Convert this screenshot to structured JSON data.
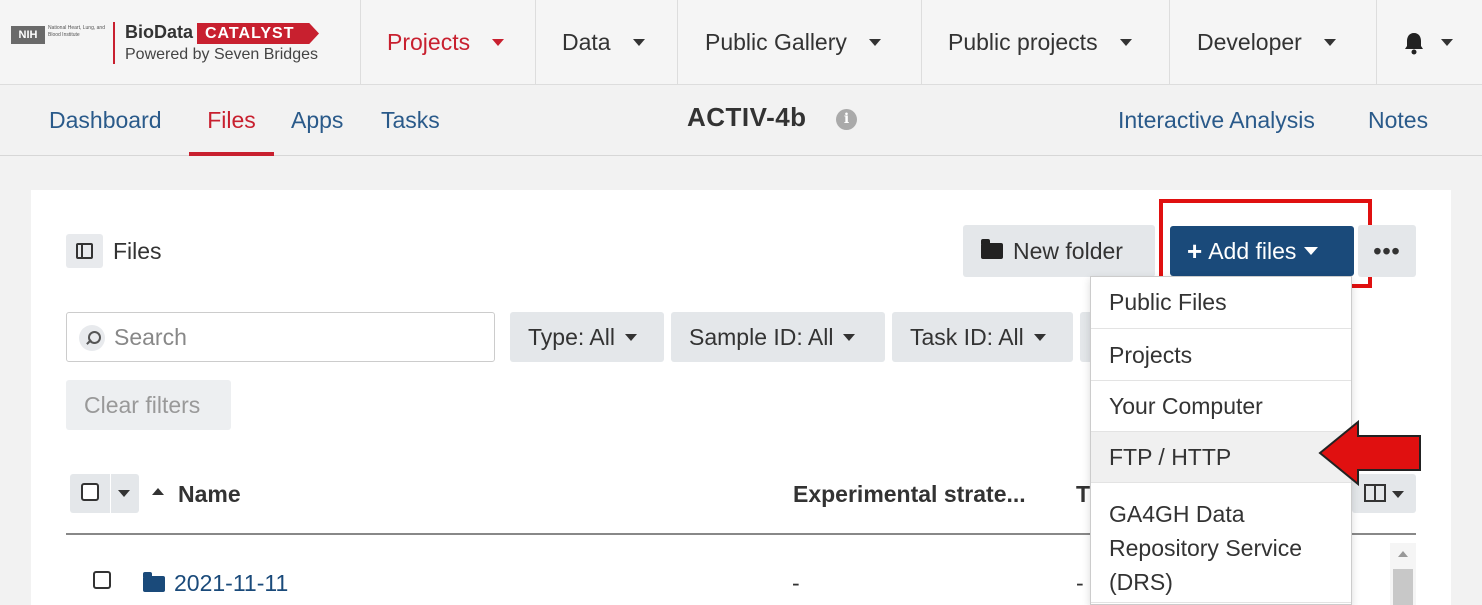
{
  "logo": {
    "nih": "NIH",
    "nih_small": "National Heart, Lung, and Blood Institute",
    "biodata": "BioData",
    "catalyst": "CATALYST",
    "powered": "Powered by Seven Bridges"
  },
  "topnav": {
    "items": [
      {
        "label": "Projects"
      },
      {
        "label": "Data"
      },
      {
        "label": "Public Gallery"
      },
      {
        "label": "Public projects"
      },
      {
        "label": "Developer"
      }
    ],
    "bell_icon": "bell-icon"
  },
  "subnav": {
    "tabs": [
      "Dashboard",
      "Files",
      "Apps",
      "Tasks"
    ],
    "project_title": "ACTIV-4b",
    "info_icon": "i",
    "right": [
      "Interactive Analysis",
      "Notes"
    ]
  },
  "files": {
    "panel_label": "Files",
    "new_folder": "New folder",
    "add_files": "Add files",
    "more": "•••",
    "search_placeholder": "Search",
    "filters": [
      "Type: All",
      "Sample ID: All",
      "Task ID: All"
    ],
    "clear_filters": "Clear filters"
  },
  "table": {
    "headers": [
      "Name",
      "Experimental strate...",
      "T"
    ],
    "rows": [
      {
        "name": "2021-11-11",
        "experimental_strategy": "-",
        "type": "-"
      }
    ]
  },
  "dropdown": {
    "items": [
      "Public Files",
      "Projects",
      "Your Computer",
      "FTP / HTTP",
      "GA4GH Data Repository Service (DRS)"
    ]
  },
  "colors": {
    "brand_red": "#c8202f",
    "primary_blue": "#1a4a7a",
    "annotation_red": "#e01010"
  }
}
